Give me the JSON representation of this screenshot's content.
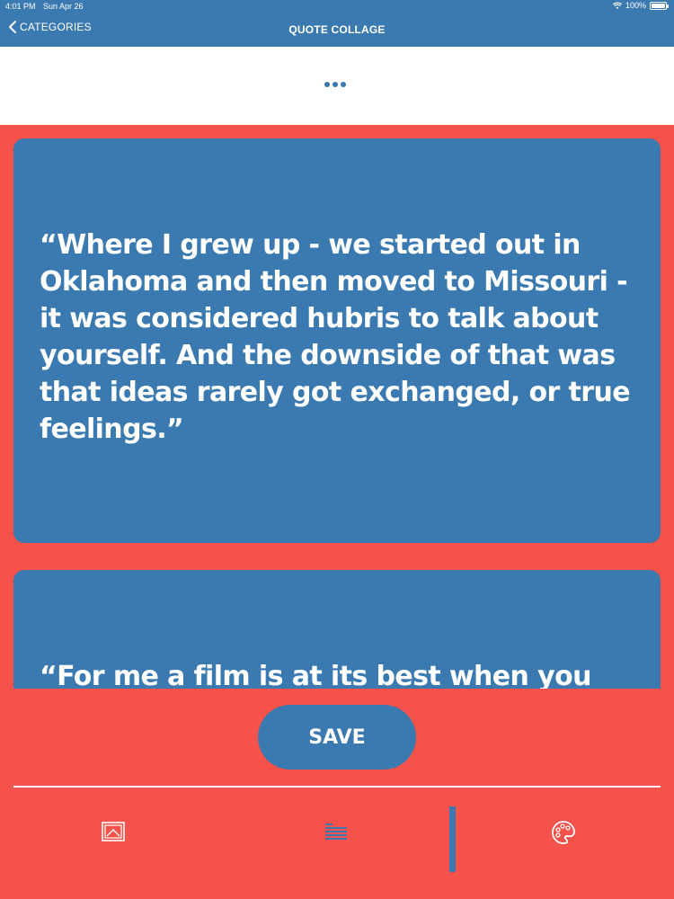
{
  "status_bar": {
    "time": "4:01 PM",
    "date": "Sun Apr 26",
    "battery": "100%",
    "battery_level": 1.0
  },
  "nav": {
    "back_label": "CATEGORIES",
    "title": "QUOTE COLLAGE"
  },
  "quotes": [
    {
      "text": "“Where I grew up - we started out in Oklahoma and then moved to Missouri - it was considered hubris to talk about yourself. And the downside of that was that ideas rarely got exchanged, or true feelings.”"
    },
    {
      "text": "“For me a film is at its best when you"
    }
  ],
  "actions": {
    "save_label": "SAVE"
  },
  "toolbar": {
    "icons": [
      "image-icon",
      "text-format-icon",
      "palette-icon"
    ]
  },
  "colors": {
    "primary": "#3A7AB0",
    "background": "#F4524A",
    "white": "#FFFFFF"
  }
}
